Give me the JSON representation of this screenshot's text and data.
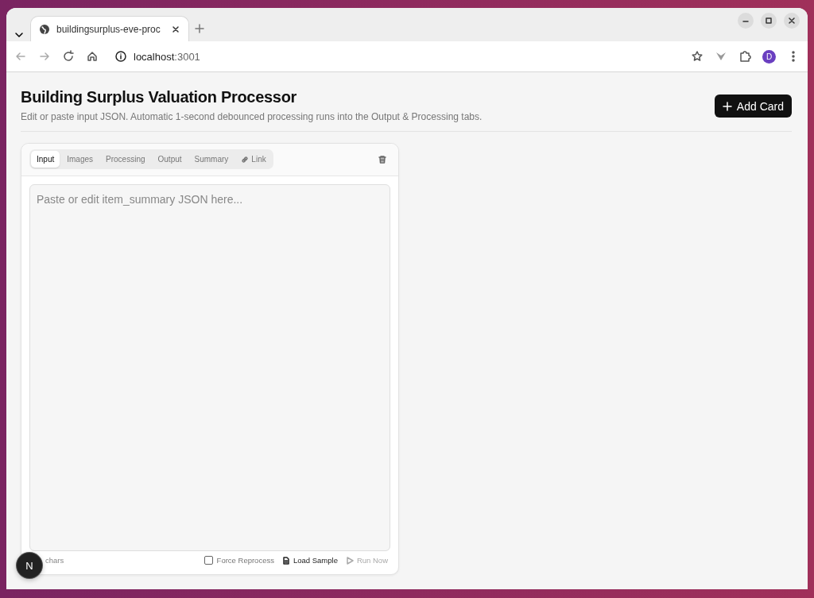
{
  "browser": {
    "tab": {
      "title": "buildingsurplus-eve-proc"
    },
    "address": {
      "host": "localhost",
      "port": ":3001"
    },
    "profile": "D"
  },
  "page": {
    "title": "Building Surplus Valuation Processor",
    "subtitle": "Edit or paste input JSON. Automatic 1-second debounced processing runs into the Output & Processing tabs.",
    "add_button": "Add Card"
  },
  "card": {
    "tabs": [
      {
        "label": "Input",
        "selected": true,
        "kind": "tab"
      },
      {
        "label": "Images",
        "selected": false,
        "kind": "tab"
      },
      {
        "label": "Processing",
        "selected": false,
        "kind": "tab"
      },
      {
        "label": "Output",
        "selected": false,
        "kind": "tab"
      },
      {
        "label": "Summary",
        "selected": false,
        "kind": "tab"
      },
      {
        "label": "Link",
        "selected": false,
        "kind": "link"
      }
    ],
    "editor": {
      "placeholder": "Paste or edit item_summary JSON here..."
    },
    "char_count": "chars",
    "force_reprocess": {
      "label": "Force Reprocess",
      "checked": false
    },
    "actions": [
      {
        "label": "Load Sample",
        "disabled": false,
        "kind": "sample"
      },
      {
        "label": "Run Now",
        "disabled": true,
        "kind": "run"
      }
    ]
  },
  "dev_badge": "N"
}
